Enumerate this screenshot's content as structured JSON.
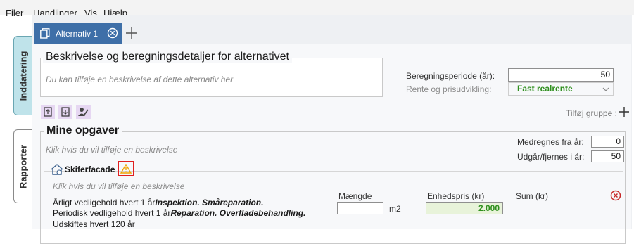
{
  "menu": [
    "Filer",
    "Handlinger",
    "Vis",
    "Hjælp"
  ],
  "side_tabs": {
    "input": "Inddatering",
    "reports": "Rapporter"
  },
  "tabs": {
    "active_label": "Alternativ 1",
    "close_icon": "close-circle-icon",
    "add_icon": "plus-icon"
  },
  "description_section": {
    "title": "Beskrivelse og beregningsdetaljer for alternativet",
    "placeholder": "Du kan tilføje en beskrivelse af dette alternativ her",
    "period_label": "Beregningsperiode (år):",
    "period_value": "50",
    "rate_label": "Rente og prisudvikling:",
    "rate_value": "Fast realrente"
  },
  "toolbar": {
    "add_group_label": "Tilføj gruppe :"
  },
  "tasks": {
    "title": "Mine opgaver",
    "placeholder": "Klik hvis du vil tilføje en beskrivelse",
    "from_year_label": "Medregnes fra år:",
    "from_year_value": "0",
    "expire_label": "Udgår/fjernes i år:",
    "expire_value": "50"
  },
  "item": {
    "name": "Skiferfacade",
    "placeholder": "Klik hvis du vil tilføje en beskrivelse",
    "line1_prefix": "Årligt vedligehold hvert 1 år",
    "line1_em": "Inspektion. Småreparation.",
    "line2_prefix": "Periodisk vedligehold hvert 1 år",
    "line2_em": "Reparation. Overfladebehandling.",
    "line3": "Udskiftes hvert 120 år",
    "qty_label": "Mængde",
    "qty_value": "",
    "unit": "m2",
    "price_label": "Enhedspris (kr)",
    "price_value": "2.000",
    "sum_label": "Sum (kr)"
  },
  "colors": {
    "tab_blue": "#3e6fa8",
    "side_tab_active": "#bfe3ea",
    "green": "#2f8f1e",
    "warning": "#f0a400",
    "error": "#c62828"
  }
}
